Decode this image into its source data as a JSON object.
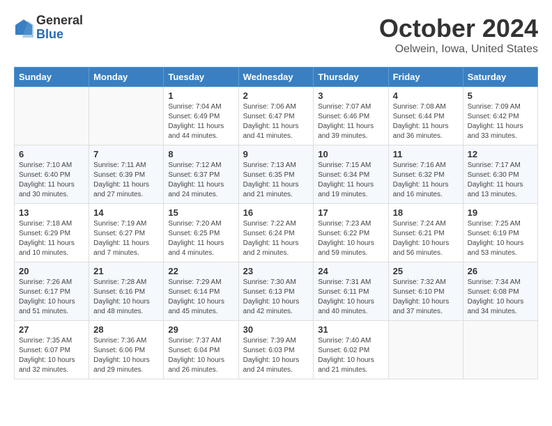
{
  "logo": {
    "general": "General",
    "blue": "Blue"
  },
  "title": "October 2024",
  "location": "Oelwein, Iowa, United States",
  "weekdays": [
    "Sunday",
    "Monday",
    "Tuesday",
    "Wednesday",
    "Thursday",
    "Friday",
    "Saturday"
  ],
  "weeks": [
    [
      {
        "day": "",
        "info": ""
      },
      {
        "day": "",
        "info": ""
      },
      {
        "day": "1",
        "info": "Sunrise: 7:04 AM\nSunset: 6:49 PM\nDaylight: 11 hours and 44 minutes."
      },
      {
        "day": "2",
        "info": "Sunrise: 7:06 AM\nSunset: 6:47 PM\nDaylight: 11 hours and 41 minutes."
      },
      {
        "day": "3",
        "info": "Sunrise: 7:07 AM\nSunset: 6:46 PM\nDaylight: 11 hours and 39 minutes."
      },
      {
        "day": "4",
        "info": "Sunrise: 7:08 AM\nSunset: 6:44 PM\nDaylight: 11 hours and 36 minutes."
      },
      {
        "day": "5",
        "info": "Sunrise: 7:09 AM\nSunset: 6:42 PM\nDaylight: 11 hours and 33 minutes."
      }
    ],
    [
      {
        "day": "6",
        "info": "Sunrise: 7:10 AM\nSunset: 6:40 PM\nDaylight: 11 hours and 30 minutes."
      },
      {
        "day": "7",
        "info": "Sunrise: 7:11 AM\nSunset: 6:39 PM\nDaylight: 11 hours and 27 minutes."
      },
      {
        "day": "8",
        "info": "Sunrise: 7:12 AM\nSunset: 6:37 PM\nDaylight: 11 hours and 24 minutes."
      },
      {
        "day": "9",
        "info": "Sunrise: 7:13 AM\nSunset: 6:35 PM\nDaylight: 11 hours and 21 minutes."
      },
      {
        "day": "10",
        "info": "Sunrise: 7:15 AM\nSunset: 6:34 PM\nDaylight: 11 hours and 19 minutes."
      },
      {
        "day": "11",
        "info": "Sunrise: 7:16 AM\nSunset: 6:32 PM\nDaylight: 11 hours and 16 minutes."
      },
      {
        "day": "12",
        "info": "Sunrise: 7:17 AM\nSunset: 6:30 PM\nDaylight: 11 hours and 13 minutes."
      }
    ],
    [
      {
        "day": "13",
        "info": "Sunrise: 7:18 AM\nSunset: 6:29 PM\nDaylight: 11 hours and 10 minutes."
      },
      {
        "day": "14",
        "info": "Sunrise: 7:19 AM\nSunset: 6:27 PM\nDaylight: 11 hours and 7 minutes."
      },
      {
        "day": "15",
        "info": "Sunrise: 7:20 AM\nSunset: 6:25 PM\nDaylight: 11 hours and 4 minutes."
      },
      {
        "day": "16",
        "info": "Sunrise: 7:22 AM\nSunset: 6:24 PM\nDaylight: 11 hours and 2 minutes."
      },
      {
        "day": "17",
        "info": "Sunrise: 7:23 AM\nSunset: 6:22 PM\nDaylight: 10 hours and 59 minutes."
      },
      {
        "day": "18",
        "info": "Sunrise: 7:24 AM\nSunset: 6:21 PM\nDaylight: 10 hours and 56 minutes."
      },
      {
        "day": "19",
        "info": "Sunrise: 7:25 AM\nSunset: 6:19 PM\nDaylight: 10 hours and 53 minutes."
      }
    ],
    [
      {
        "day": "20",
        "info": "Sunrise: 7:26 AM\nSunset: 6:17 PM\nDaylight: 10 hours and 51 minutes."
      },
      {
        "day": "21",
        "info": "Sunrise: 7:28 AM\nSunset: 6:16 PM\nDaylight: 10 hours and 48 minutes."
      },
      {
        "day": "22",
        "info": "Sunrise: 7:29 AM\nSunset: 6:14 PM\nDaylight: 10 hours and 45 minutes."
      },
      {
        "day": "23",
        "info": "Sunrise: 7:30 AM\nSunset: 6:13 PM\nDaylight: 10 hours and 42 minutes."
      },
      {
        "day": "24",
        "info": "Sunrise: 7:31 AM\nSunset: 6:11 PM\nDaylight: 10 hours and 40 minutes."
      },
      {
        "day": "25",
        "info": "Sunrise: 7:32 AM\nSunset: 6:10 PM\nDaylight: 10 hours and 37 minutes."
      },
      {
        "day": "26",
        "info": "Sunrise: 7:34 AM\nSunset: 6:08 PM\nDaylight: 10 hours and 34 minutes."
      }
    ],
    [
      {
        "day": "27",
        "info": "Sunrise: 7:35 AM\nSunset: 6:07 PM\nDaylight: 10 hours and 32 minutes."
      },
      {
        "day": "28",
        "info": "Sunrise: 7:36 AM\nSunset: 6:06 PM\nDaylight: 10 hours and 29 minutes."
      },
      {
        "day": "29",
        "info": "Sunrise: 7:37 AM\nSunset: 6:04 PM\nDaylight: 10 hours and 26 minutes."
      },
      {
        "day": "30",
        "info": "Sunrise: 7:39 AM\nSunset: 6:03 PM\nDaylight: 10 hours and 24 minutes."
      },
      {
        "day": "31",
        "info": "Sunrise: 7:40 AM\nSunset: 6:02 PM\nDaylight: 10 hours and 21 minutes."
      },
      {
        "day": "",
        "info": ""
      },
      {
        "day": "",
        "info": ""
      }
    ]
  ]
}
